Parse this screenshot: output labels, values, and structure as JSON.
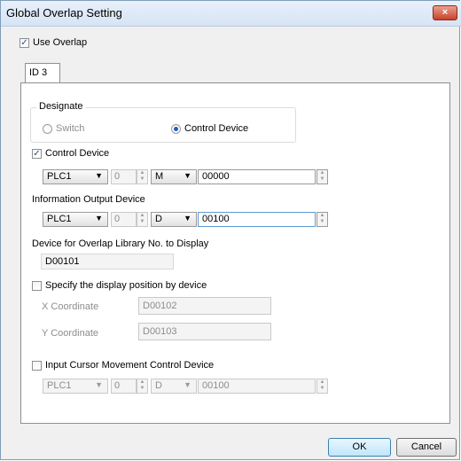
{
  "window": {
    "title": "Global Overlap Setting",
    "close_label": "×"
  },
  "use_overlap": {
    "label": "Use Overlap",
    "checked": true
  },
  "tabs": [
    {
      "label": "ID 3"
    }
  ],
  "designate": {
    "legend": "Designate",
    "options": [
      {
        "label": "Switch",
        "selected": false
      },
      {
        "label": "Control Device",
        "selected": true
      }
    ]
  },
  "control_device": {
    "label": "Control Device",
    "checked": true,
    "plc": "PLC1",
    "station": "0",
    "device_type": "M",
    "address": "00000"
  },
  "info_output": {
    "label": "Information Output Device",
    "plc": "PLC1",
    "station": "0",
    "device_type": "D",
    "address": "00100"
  },
  "library_no": {
    "label": "Device for Overlap Library No. to Display",
    "value": "D00101"
  },
  "display_position": {
    "label": "Specify the display position by device",
    "checked": false,
    "x_label": "X Coordinate",
    "x_value": "D00102",
    "y_label": "Y Coordinate",
    "y_value": "D00103"
  },
  "cursor_device": {
    "label": "Input Cursor Movement Control Device",
    "checked": false,
    "plc": "PLC1",
    "station": "0",
    "device_type": "D",
    "address": "00100"
  },
  "buttons": {
    "ok": "OK",
    "cancel": "Cancel"
  },
  "icons": {
    "dropdown": "▼",
    "spin_up": "▲",
    "spin_down": "▼",
    "check": "✓"
  }
}
